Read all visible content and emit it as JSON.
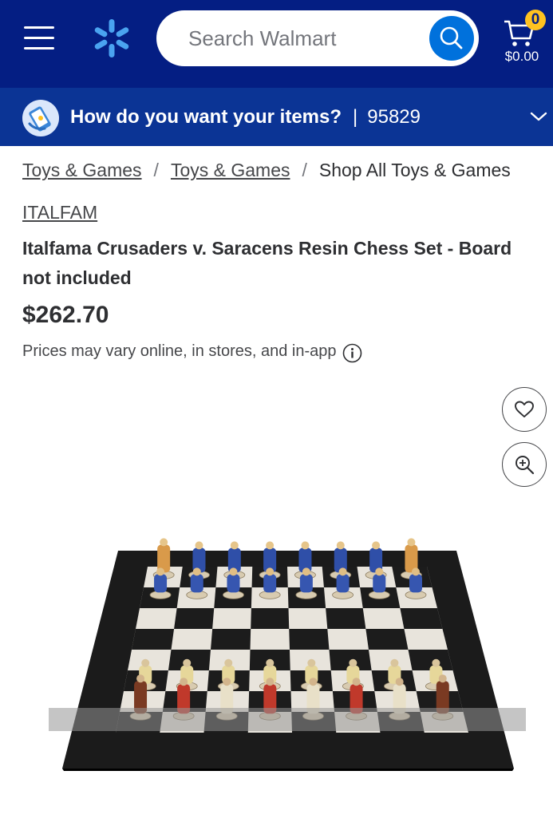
{
  "colors": {
    "header_bg": "#041e83",
    "fulfillment_bg": "#0b3495",
    "search_button": "#0071dc",
    "spark_yellow": "#ffc220"
  },
  "header": {
    "menu_icon": "hamburger-menu-icon",
    "logo_icon": "walmart-spark-icon",
    "search": {
      "placeholder": "Search Walmart",
      "value": "",
      "button_icon": "search-icon"
    },
    "cart": {
      "icon": "cart-icon",
      "count": "0",
      "total": "$0.00"
    }
  },
  "fulfillment": {
    "icon": "phone-delivery-icon",
    "title": "How do you want your items?",
    "separator": "|",
    "zip": "95829",
    "chevron_icon": "chevron-down-icon"
  },
  "breadcrumb": {
    "items": [
      "Toys & Games",
      "Toys & Games",
      "Shop All Toys & Games"
    ],
    "separator": "/"
  },
  "product": {
    "brand": "ITALFAM",
    "title": "Italfama Crusaders v. Saracens Resin Chess Set - Board not included",
    "price": "$262.70",
    "price_note": "Prices may vary online, in stores, and in-app",
    "info_icon": "info-icon",
    "favorite_icon": "heart-icon",
    "zoom_icon": "zoom-in-icon",
    "image_subject": "chess-set-image"
  }
}
